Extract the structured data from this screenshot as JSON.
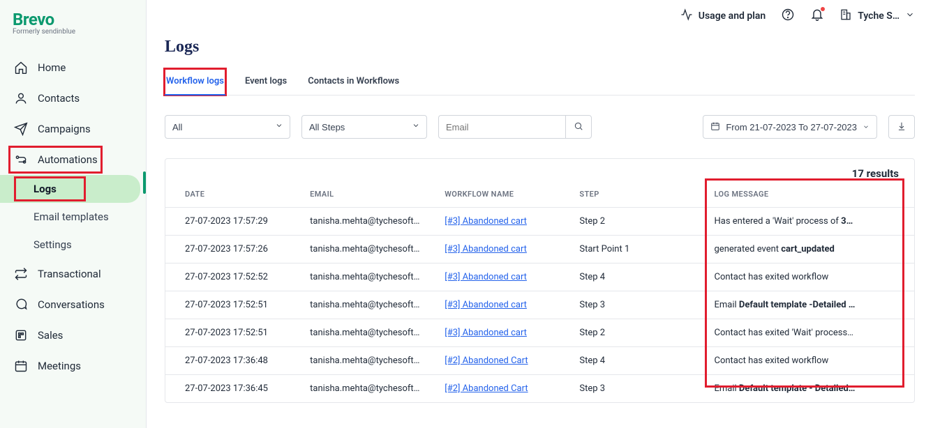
{
  "brand": {
    "name": "Brevo",
    "sub": "Formerly sendinblue"
  },
  "sidebar": {
    "items": [
      {
        "label": "Home"
      },
      {
        "label": "Contacts"
      },
      {
        "label": "Campaigns"
      },
      {
        "label": "Automations"
      },
      {
        "label": "Transactional"
      },
      {
        "label": "Conversations"
      },
      {
        "label": "Sales"
      },
      {
        "label": "Meetings"
      }
    ],
    "subitems": [
      {
        "label": "Logs"
      },
      {
        "label": "Email templates"
      },
      {
        "label": "Settings"
      }
    ]
  },
  "topbar": {
    "usage": "Usage and plan",
    "account": "Tyche S…"
  },
  "page": {
    "title": "Logs"
  },
  "tabs": [
    {
      "label": "Workflow logs"
    },
    {
      "label": "Event logs"
    },
    {
      "label": "Contacts in Workflows"
    }
  ],
  "filters": {
    "all": "All",
    "allsteps": "All Steps",
    "email_placeholder": "Email",
    "daterange": "From 21-07-2023 To 27-07-2023"
  },
  "results": {
    "count": "17 results"
  },
  "columns": {
    "date": "DATE",
    "email": "EMAIL",
    "workflow": "WORKFLOW NAME",
    "step": "STEP",
    "logmsg": "LOG MESSAGE"
  },
  "rows": [
    {
      "date": "27-07-2023 17:57:29",
      "email": "tanisha.mehta@tychesoftwares.c…",
      "workflow": "[#3] Abandoned cart",
      "step": "Step 2",
      "logmsg_pre": "Has entered a 'Wait' process of ",
      "logmsg_bold": "3…",
      "logmsg_post": ""
    },
    {
      "date": "27-07-2023 17:57:26",
      "email": "tanisha.mehta@tychesoftwares.c…",
      "workflow": "[#3] Abandoned cart",
      "step": "Start Point 1",
      "logmsg_pre": "generated event ",
      "logmsg_bold": "cart_updated",
      "logmsg_post": ""
    },
    {
      "date": "27-07-2023 17:52:52",
      "email": "tanisha.mehta@tychesoftwares.c…",
      "workflow": "[#3] Abandoned cart",
      "step": "Step 4",
      "logmsg_pre": "Contact has exited workflow",
      "logmsg_bold": "",
      "logmsg_post": ""
    },
    {
      "date": "27-07-2023 17:52:51",
      "email": "tanisha.mehta@tychesoftwares.c…",
      "workflow": "[#3] Abandoned cart",
      "step": "Step 3",
      "logmsg_pre": "Email ",
      "logmsg_bold": "Default template -Detailed …",
      "logmsg_post": ""
    },
    {
      "date": "27-07-2023 17:52:51",
      "email": "tanisha.mehta@tychesoftwares.c…",
      "workflow": "[#3] Abandoned cart",
      "step": "Step 2",
      "logmsg_pre": "Contact has exited 'Wait' process…",
      "logmsg_bold": "",
      "logmsg_post": ""
    },
    {
      "date": "27-07-2023 17:36:48",
      "email": "tanisha.mehta@tychesoftwares.c…",
      "workflow": "[#2] Abandoned Cart",
      "step": "Step 4",
      "logmsg_pre": "Contact has exited workflow",
      "logmsg_bold": "",
      "logmsg_post": ""
    },
    {
      "date": "27-07-2023 17:36:45",
      "email": "tanisha.mehta@tychesoftwares.c…",
      "workflow": "[#2] Abandoned Cart",
      "step": "Step 3",
      "logmsg_pre": "Email ",
      "logmsg_bold": "Default template - Detailed…",
      "logmsg_post": ""
    }
  ]
}
